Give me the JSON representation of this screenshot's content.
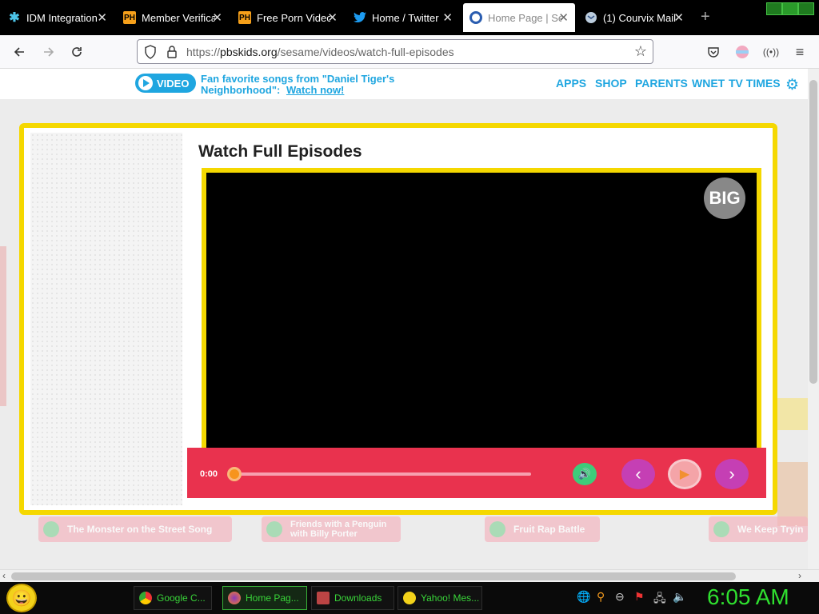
{
  "browser": {
    "tabs": [
      {
        "label": "IDM Integration",
        "icon": "idm-icon",
        "active": false
      },
      {
        "label": "Member Verificati",
        "icon": "ph-icon",
        "active": false
      },
      {
        "label": "Free Porn Videos",
        "icon": "ph-icon",
        "active": false
      },
      {
        "label": "Home / Twitter",
        "icon": "twitter-icon",
        "active": false
      },
      {
        "label": "Home Page | Sesa",
        "icon": "pbs-kids-icon",
        "active": true
      },
      {
        "label": "(1) Courvix Mail",
        "icon": "courvix-mail-icon",
        "active": false
      }
    ],
    "tab_close_glyph": "✕",
    "ph_icon_text": "PH",
    "new_tab_glyph": "+",
    "url_prefix": "https://",
    "url_domain": "pbskids.org",
    "url_path": "/sesame/videos/watch-full-episodes"
  },
  "header": {
    "video_pill": "VIDEO",
    "promo_text": "Fan favorite songs from \"Daniel Tiger's Neighborhood\":",
    "promo_link": "Watch now!",
    "nav": [
      "APPS",
      "SHOP",
      "PARENTS",
      "WNET",
      "TV TIMES"
    ]
  },
  "player": {
    "title": "Watch Full Episodes",
    "big_label": "BIG",
    "time": "0:00",
    "progress": 0,
    "colors": {
      "frame": "#f5d800",
      "control_bar": "#e9324e",
      "nav_buttons": "#c53fb4"
    }
  },
  "related": [
    {
      "label": "The Monster on the Street Song"
    },
    {
      "label": "Friends with a Penguin with Billy Porter"
    },
    {
      "label": "Fruit Rap Battle"
    },
    {
      "label": "We Keep Tryin"
    }
  ],
  "taskbar": {
    "tasks": [
      {
        "label": "Google C...",
        "icon": "chrome-icon"
      },
      {
        "label": "Home Pag...",
        "icon": "firefox-icon"
      },
      {
        "label": "Downloads",
        "icon": "downloads-icon"
      },
      {
        "label": "Yahoo! Mes...",
        "icon": "yahoo-messenger-icon"
      }
    ],
    "clock": "6:05 AM"
  }
}
